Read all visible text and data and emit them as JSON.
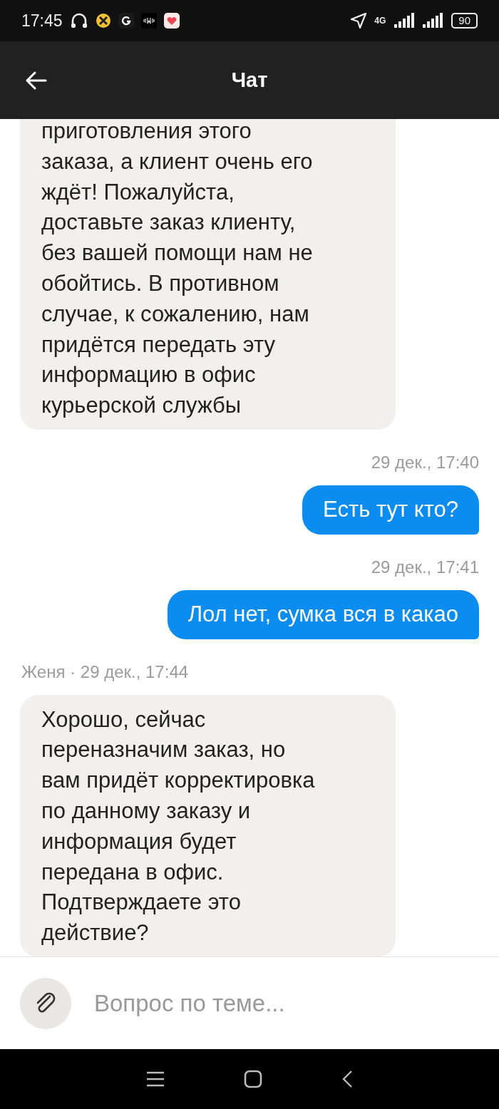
{
  "status_bar": {
    "time": "17:45",
    "network": "4G",
    "battery": "90"
  },
  "header": {
    "title": "Чат"
  },
  "messages": [
    {
      "kind": "incoming",
      "text": "приготовления этого\nзаказа, а клиент очень его\nждёт! Пожалуйста,\nдоставьте заказ клиенту,\nбез вашей помощи нам не\nобойтись. В противном\nслучае, к сожалению, нам\nпридётся передать эту\nинформацию в офис\nкурьерской службы"
    },
    {
      "kind": "timestamp",
      "text": "29 дек., 17:40"
    },
    {
      "kind": "outgoing",
      "text": "Есть тут кто?"
    },
    {
      "kind": "timestamp",
      "text": "29 дек., 17:41"
    },
    {
      "kind": "outgoing",
      "text": "Лол нет, сумка вся в какао"
    },
    {
      "kind": "sender",
      "text": "Женя · 29 дек., 17:44"
    },
    {
      "kind": "incoming",
      "text": "Хорошо, сейчас\nпереназначим заказ, но\nвам придёт корректировка\nпо данному заказу и\nинформация будет\nпередана в офис.\nПодтверждаете это\nдействие?"
    }
  ],
  "composer": {
    "placeholder": "Вопрос по теме..."
  }
}
